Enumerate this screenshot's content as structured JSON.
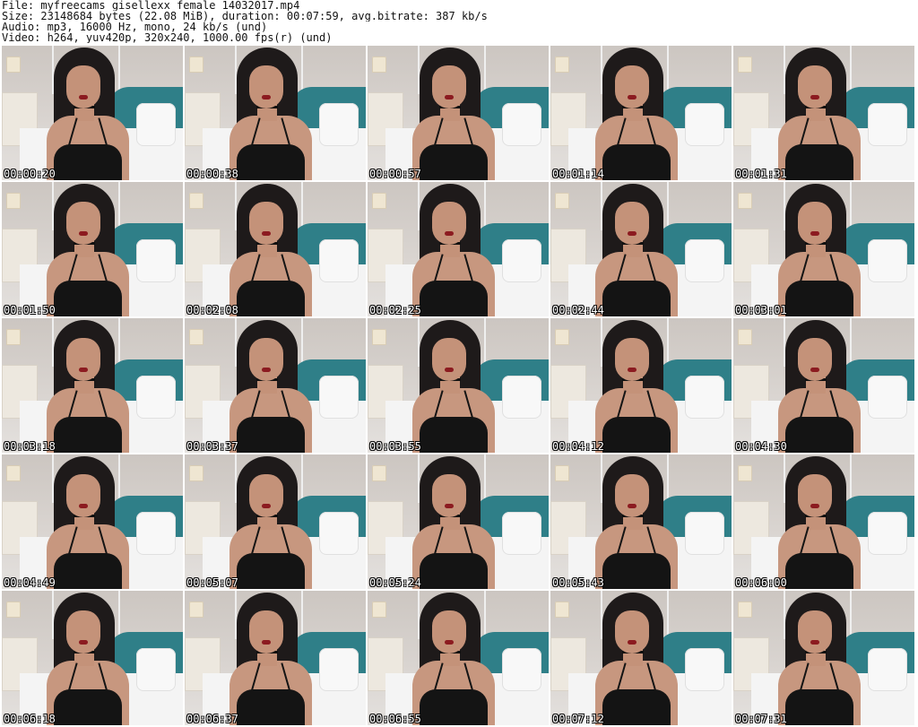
{
  "header": {
    "line1": "File: myfreecams_gisellexx_female_14032017.mp4",
    "line2": "Size: 23148684 bytes (22.08 MiB), duration: 00:07:59, avg.bitrate: 387 kb/s",
    "line3": "Audio: mp3, 16000 Hz, mono, 24 kb/s (und)",
    "line4": "Video: h264, yuv420p, 320x240, 1000.00 fps(r) (und)"
  },
  "thumbnails": [
    {
      "timestamp": "00:00:20"
    },
    {
      "timestamp": "00:00:38"
    },
    {
      "timestamp": "00:00:57"
    },
    {
      "timestamp": "00:01:14"
    },
    {
      "timestamp": "00:01:31"
    },
    {
      "timestamp": "00:01:50"
    },
    {
      "timestamp": "00:02:08"
    },
    {
      "timestamp": "00:02:25"
    },
    {
      "timestamp": "00:02:44"
    },
    {
      "timestamp": "00:03:01"
    },
    {
      "timestamp": "00:03:18"
    },
    {
      "timestamp": "00:03:37"
    },
    {
      "timestamp": "00:03:55"
    },
    {
      "timestamp": "00:04:12"
    },
    {
      "timestamp": "00:04:30"
    },
    {
      "timestamp": "00:04:49"
    },
    {
      "timestamp": "00:05:07"
    },
    {
      "timestamp": "00:05:24"
    },
    {
      "timestamp": "00:05:43"
    },
    {
      "timestamp": "00:06:00"
    },
    {
      "timestamp": "00:06:18"
    },
    {
      "timestamp": "00:06:37"
    },
    {
      "timestamp": "00:06:55"
    },
    {
      "timestamp": "00:07:12"
    },
    {
      "timestamp": "00:07:31"
    }
  ]
}
